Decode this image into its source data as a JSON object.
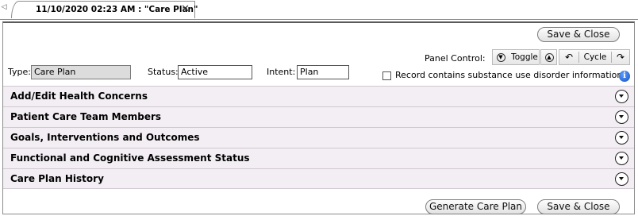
{
  "tab": {
    "scroll_left_glyph": "◁",
    "label": "11/10/2020 02:23 AM : \"Care Plan\"",
    "close_glyph": "✕"
  },
  "toolbar": {
    "save_close_label": "Save & Close"
  },
  "form": {
    "type_label": "Type:",
    "type_value": "Care Plan",
    "status_label": "Status:",
    "status_value": "Active",
    "intent_label": "Intent:",
    "intent_value": "Plan"
  },
  "panel_control": {
    "label": "Panel Control:",
    "toggle_label": "Toggle",
    "cycle_label": "Cycle",
    "collapse_glyph": "▼",
    "expand_glyph": "▲",
    "prev_glyph": "↶",
    "next_glyph": "↷"
  },
  "substance_checkbox": {
    "label": "Record contains substance use disorder information",
    "checked": false
  },
  "info_glyph": "i",
  "sections": [
    {
      "title": "Add/Edit Health Concerns"
    },
    {
      "title": "Patient Care Team Members"
    },
    {
      "title": "Goals, Interventions and Outcomes"
    },
    {
      "title": "Functional and Cognitive Assessment Status"
    },
    {
      "title": "Care Plan History"
    }
  ],
  "footer": {
    "generate_label": "Generate Care Plan",
    "save_close_label": "Save & Close"
  }
}
